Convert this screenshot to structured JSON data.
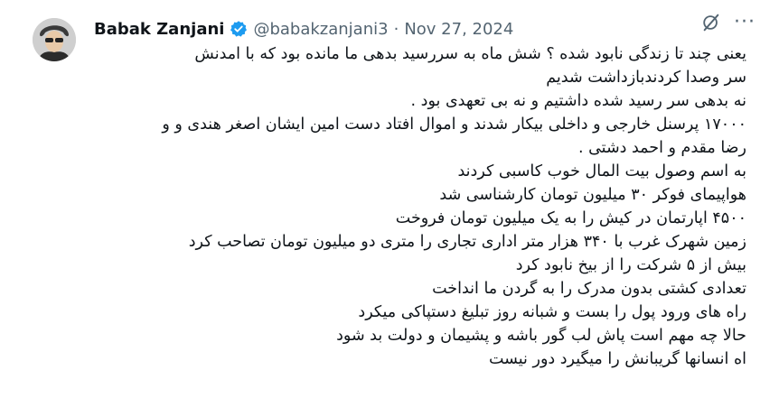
{
  "author": {
    "name": "Babak Zanjani",
    "handle": "@babakzanjani3",
    "separator": "·",
    "date": "Nov 27, 2024"
  },
  "icons": {
    "avatar": "profile-photo",
    "verified": "verified-badge-icon",
    "grok": "grok-icon",
    "more": "more-options-icon"
  },
  "colors": {
    "verified_blue": "#1d9bf0",
    "muted": "#536471"
  },
  "more_label": "···",
  "tweet": {
    "lines": [
      "یعنی چند تا زندگی  نابود شده ؟  شش ماه به سررسید بدهی ما مانده بود که با امدنش",
      "سر وصدا کردندبازداشت شدیم",
      "نه بدهی سر رسید شده  داشتیم و نه بی تعهدی بود .",
      "۱۷۰۰۰ پرسنل خارجی و داخلی بیکار شدند و اموال افتاد دست امین ایشان اصغر هندی و و",
      "رضا مقدم و احمد دشتی .",
      "به اسم وصول بیت المال خوب کاسبی کردند",
      "هواپیمای فوکر ۳۰ میلیون تومان کارشناسی شد",
      "۴۵۰۰ اپارتمان در کیش را به یک میلیون تومان فروخت",
      "زمین شهرک غرب با ۳۴۰ هزار متر اداری تجاری را متری دو میلیون تومان تصاحب کرد",
      "بیش از ۵ شرکت را از بیخ نابود کرد",
      "تعدادی کشتی بدون مدرک را به گردن ما انداخت",
      "راه های ورود پول را بست و شبانه روز تبلیغ دستپاکی میکرد",
      "حالا چه مهم است پاش لب گور باشه و پشیمان و دولت بد شود",
      "اه انسانها گریبانش را میگیرد دور نیست"
    ]
  }
}
